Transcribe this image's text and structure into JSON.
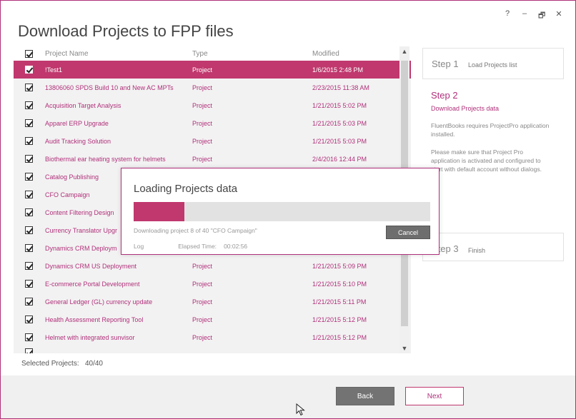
{
  "window_controls": {
    "help": "?",
    "minimize": "–",
    "restore": "🗗",
    "close": "✕"
  },
  "title": "Download Projects to FPP files",
  "table": {
    "headers": {
      "name": "Project Name",
      "type": "Type",
      "modified": "Modified"
    },
    "rows": [
      {
        "name": "!Test1",
        "type": "Project",
        "modified": "1/6/2015 2:48 PM",
        "selected": true
      },
      {
        "name": "13806060 SPDS Build 10 and New AC MPTs",
        "type": "Project",
        "modified": "2/23/2015 11:38 AM"
      },
      {
        "name": "Acquisition Target Analysis",
        "type": "Project",
        "modified": "1/21/2015 5:02 PM"
      },
      {
        "name": "Apparel ERP Upgrade",
        "type": "Project",
        "modified": "1/21/2015 5:03 PM"
      },
      {
        "name": "Audit Tracking Solution",
        "type": "Project",
        "modified": "1/21/2015 5:03 PM"
      },
      {
        "name": "Biothermal ear heating system for helmets",
        "type": "Project",
        "modified": "2/4/2016 12:44 PM"
      },
      {
        "name": "Catalog Publishing",
        "type": "",
        "modified": ""
      },
      {
        "name": "CFO Campaign",
        "type": "",
        "modified": ""
      },
      {
        "name": "Content Filtering Design",
        "type": "",
        "modified": ""
      },
      {
        "name": "Currency Translator Upgr",
        "type": "",
        "modified": ""
      },
      {
        "name": "Dynamics CRM Deploym",
        "type": "",
        "modified": ""
      },
      {
        "name": "Dynamics CRM US Deployment",
        "type": "Project",
        "modified": "1/21/2015 5:09 PM"
      },
      {
        "name": "E-commerce Portal Development",
        "type": "Project",
        "modified": "1/21/2015 5:10 PM"
      },
      {
        "name": "General Ledger (GL) currency update",
        "type": "Project",
        "modified": "1/21/2015 5:11 PM"
      },
      {
        "name": "Health Assessment Reporting Tool",
        "type": "Project",
        "modified": "1/21/2015 5:12 PM"
      },
      {
        "name": "Helmet with integrated sunvisor",
        "type": "Project",
        "modified": "1/21/2015 5:12 PM"
      }
    ]
  },
  "selected_label": "Selected Projects:",
  "selected_value": "40/40",
  "steps": {
    "step1": {
      "title": "Step 1",
      "sub": "Load Projects list"
    },
    "step2": {
      "title": "Step 2",
      "sub": "Download Projects data",
      "p1": "FluentBooks requires ProjectPro application installed.",
      "p2": "Please make sure that Project Pro application is activated and configured to start with default account without dialogs."
    },
    "step3": {
      "title": "Step 3",
      "sub": "Finish"
    }
  },
  "footer": {
    "back": "Back",
    "next": "Next"
  },
  "modal": {
    "title": "Loading Projects data",
    "progress": 0.17,
    "status": "Downloading project 8 of 40 \"CFO Campaign\"",
    "cancel": "Cancel",
    "log": "Log",
    "elapsed_label": "Elapsed Time:",
    "elapsed_value": "00:02:56"
  },
  "colors": {
    "accent": "#c0386e",
    "link": "#b0307a",
    "button_gray": "#737373"
  }
}
